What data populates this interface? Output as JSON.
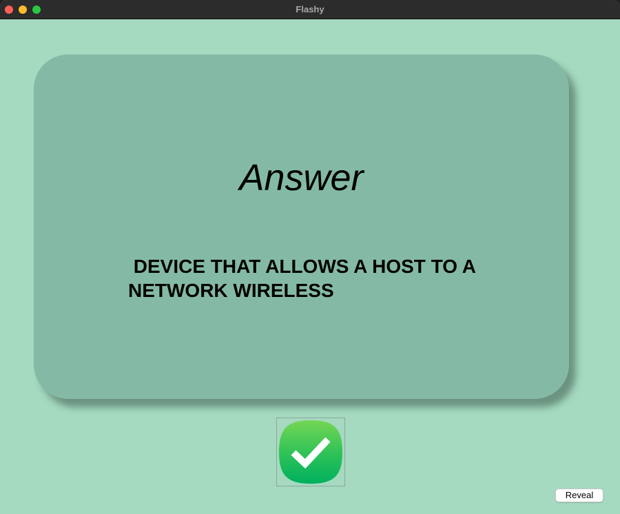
{
  "window": {
    "title": "Flashy"
  },
  "card": {
    "title": "Answer",
    "text": " DEVICE THAT ALLOWS A HOST TO A\nNETWORK WIRELESS"
  },
  "actions": {
    "check_icon": "checkmark-icon",
    "reveal_label": "Reveal"
  },
  "colors": {
    "background": "#a5d9c0",
    "card": "#84baa5",
    "check_green_top": "#6fd65a",
    "check_green_bottom": "#00b05a"
  }
}
